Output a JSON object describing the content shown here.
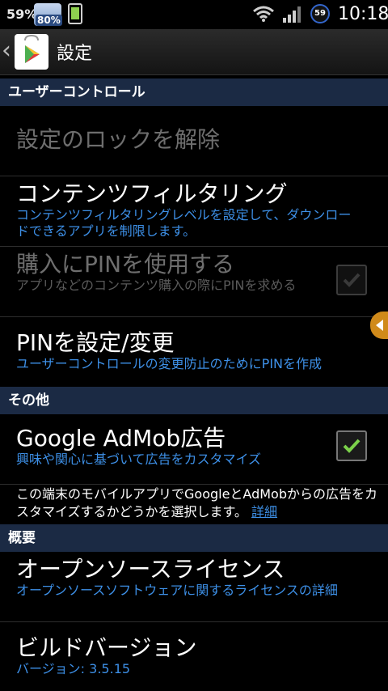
{
  "status_bar": {
    "battery_percent": "59%",
    "weather_percent": "80%",
    "battery_level": "59",
    "time": "10:18"
  },
  "action_bar": {
    "title": "設定",
    "back_icon": "chevron-left-icon",
    "app_icon": "play-store-icon"
  },
  "sections": {
    "user_controls": {
      "header": "ユーザーコントロール",
      "unlock": {
        "title": "設定のロックを解除"
      },
      "content_filtering": {
        "title": "コンテンツフィルタリング",
        "summary": "コンテンツフィルタリングレベルを設定して、ダウンロードできるアプリを制限します。"
      },
      "pin_purchase": {
        "title": "購入にPINを使用する",
        "summary": "アプリなどのコンテンツ購入の際にPINを求める",
        "checked": false
      },
      "set_pin": {
        "title": "PINを設定/変更",
        "summary": "ユーザーコントロールの変更防止のためにPINを作成"
      }
    },
    "other": {
      "header": "その他",
      "admob": {
        "title": "Google AdMob広告",
        "summary": "興味や関心に基づいて広告をカスタマイズ",
        "checked": true
      },
      "note": {
        "text": "この端末のモバイルアプリでGoogleとAdMobからの広告をカスタマイズするかどうかを選択します。",
        "link": "詳細"
      }
    },
    "overview": {
      "header": "概要",
      "licenses": {
        "title": "オープンソースライセンス",
        "summary": "オープンソースソフトウェアに関するライセンスの詳細"
      },
      "build": {
        "title": "ビルドバージョン",
        "summary": "バージョン: 3.5.15"
      }
    }
  },
  "colors": {
    "section_header_bg": "#1b2a44",
    "summary_blue": "#3d8fe6",
    "check_green": "#7bd14a"
  }
}
